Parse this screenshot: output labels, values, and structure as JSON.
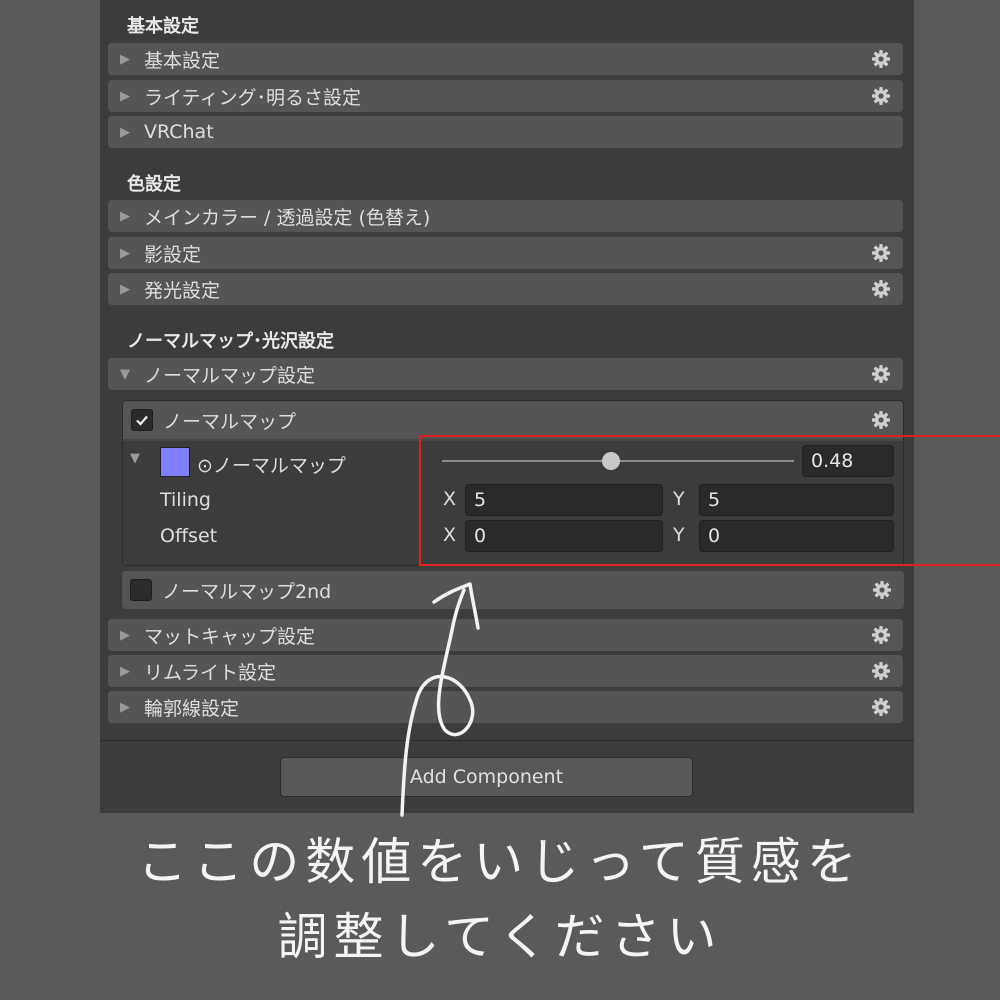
{
  "sections": {
    "basic_title": "基本設定",
    "color_title": "色設定",
    "normal_title": "ノーマルマップ･光沢設定"
  },
  "folds": {
    "basic": "基本設定",
    "lighting": "ライティング･明るさ設定",
    "vrchat": "VRChat",
    "main_color": "メインカラー / 透過設定 (色替え)",
    "shadow": "影設定",
    "emission": "発光設定",
    "normal_settings": "ノーマルマップ設定",
    "matcap": "マットキャップ設定",
    "rimlight": "リムライト設定",
    "outline": "輪郭線設定"
  },
  "normal_map": {
    "toggle_label": "ノーマルマップ",
    "toggle_checked": true,
    "texture_label": "⊙ノーマルマップ",
    "swatch_color": "#8080ff",
    "strength_value": "0.48",
    "strength_fraction": 0.48,
    "tiling_label": "Tiling",
    "offset_label": "Offset",
    "tiling_x": "5",
    "tiling_y": "5",
    "offset_x": "0",
    "offset_y": "0",
    "axis_x": "X",
    "axis_y": "Y"
  },
  "normal_map_2nd": {
    "label": "ノーマルマップ2nd",
    "checked": false
  },
  "add_component_label": "Add Component",
  "caption": {
    "line1": "ここの数値をいじって質感を",
    "line2": "調整してください"
  },
  "colors": {
    "highlight_frame": "#e02020",
    "panel_bg": "#3c3c3c",
    "foldout_bg": "#555555"
  }
}
